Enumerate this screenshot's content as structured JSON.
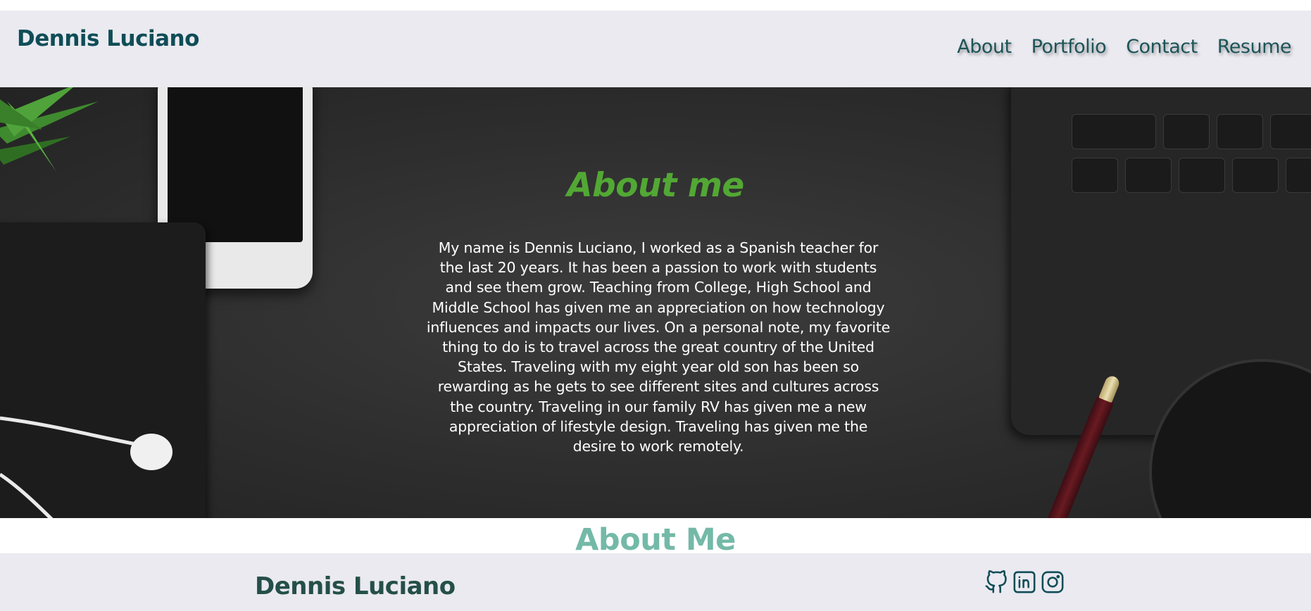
{
  "header": {
    "brand": "Dennis Luciano",
    "nav": [
      {
        "label": "About"
      },
      {
        "label": "Portfolio"
      },
      {
        "label": "Contact"
      },
      {
        "label": "Resume"
      }
    ]
  },
  "hero": {
    "title": "About me",
    "body": "My name is Dennis Luciano, I worked as a Spanish teacher for the last 20 years. It has been a passion to work with students and see them grow. Teaching from College, High School and Middle School has given me an appreciation on how technology influences and impacts our lives. On a personal note, my favorite thing to do is to travel across the great country of the United States. Traveling with my eight year old son has been so rewarding as he gets to see different sites and cultures across the country. Traveling in our family RV has given me a new appreciation of lifestyle design. Traveling has given me the desire to work remotely."
  },
  "section": {
    "title": "About Me"
  },
  "footer": {
    "name": "Dennis Luciano",
    "social": [
      {
        "icon": "github-icon"
      },
      {
        "icon": "linkedin-icon"
      },
      {
        "icon": "instagram-icon"
      }
    ]
  },
  "colors": {
    "header_bg": "#eaeaf0",
    "brand": "#0f4d57",
    "hero_title": "#52a834",
    "section_title": "#74b9a8",
    "footer_name": "#254f49"
  }
}
